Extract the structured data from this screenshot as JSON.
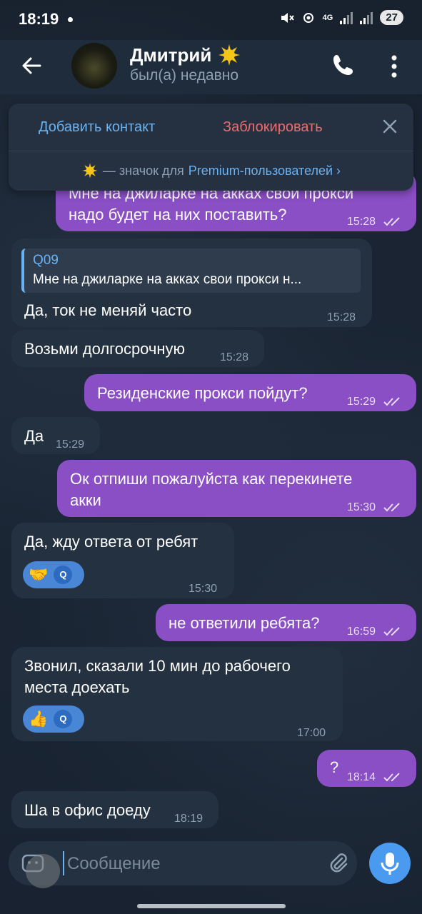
{
  "status_bar": {
    "time": "18:19",
    "network": "4G",
    "battery": "27"
  },
  "header": {
    "contact_name": "Дмитрий",
    "contact_status": "был(а) недавно"
  },
  "action_panel": {
    "add_contact": "Добавить контакт",
    "block": "Заблокировать",
    "premium_prefix": "— значок для",
    "premium_link": "Premium-пользователей ›"
  },
  "messages": [
    {
      "dir": "out",
      "text_line1": "Мне на джиларке на акках свои прокси",
      "text_line2": "надо будет на них поставить?",
      "time": "15:28"
    },
    {
      "dir": "in",
      "reply_author": "Q09",
      "reply_text": "Мне на джиларке на акках свои прокси н...",
      "text": "Да, ток не меняй часто",
      "time": "15:28"
    },
    {
      "dir": "in",
      "text": "Возьми долгосрочную",
      "time": "15:28"
    },
    {
      "dir": "out",
      "text": "Резиденские прокси пойдут?",
      "time": "15:29"
    },
    {
      "dir": "in",
      "text": "Да",
      "time": "15:29"
    },
    {
      "dir": "out",
      "text_line1": "Ок отпиши пожалуйста как перекинете",
      "text_line2": "акки",
      "time": "15:30"
    },
    {
      "dir": "in",
      "text": "Да, жду ответа от ребят",
      "reaction": "🤝",
      "reaction_user": "Q",
      "time": "15:30"
    },
    {
      "dir": "out",
      "text": "не ответили ребята?",
      "time": "16:59"
    },
    {
      "dir": "in",
      "text_line1": "Звонил, сказали 10 мин до рабочего",
      "text_line2": "места доехать",
      "reaction": "👍",
      "reaction_user": "Q",
      "time": "17:00"
    },
    {
      "dir": "out",
      "text": "?",
      "time": "18:14"
    },
    {
      "dir": "in",
      "text": "Ша в офис доеду",
      "time": "18:19"
    }
  ],
  "input": {
    "placeholder": "Сообщение"
  },
  "colors": {
    "accent": "#6ab2f2",
    "outgoing_bubble": "#8a4ec5",
    "incoming_bubble": "#243140",
    "block_red": "#ef6a6a",
    "mic_button": "#4a9af0"
  }
}
